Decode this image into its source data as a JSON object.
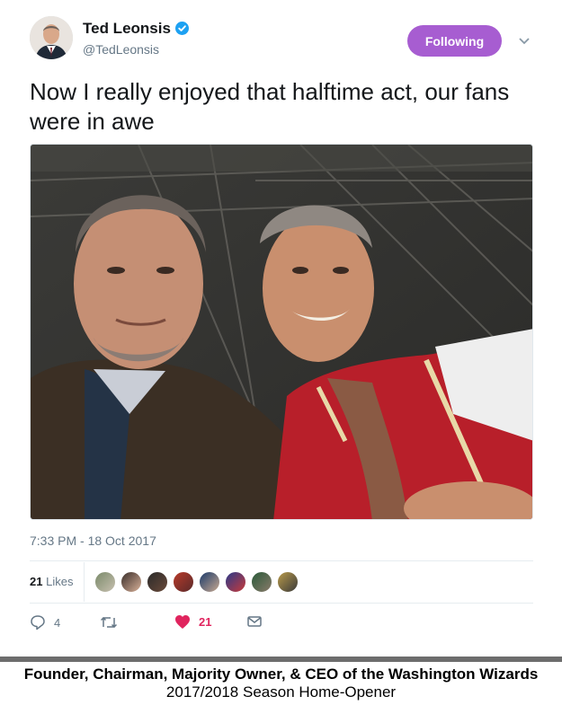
{
  "author": {
    "name": "Ted Leonsis",
    "handle": "@TedLeonsis",
    "verified_icon": "verified-badge-icon"
  },
  "follow_button": {
    "label": "Following",
    "color": "#a75dd1"
  },
  "menu_icon": "chevron-down-icon",
  "tweet": {
    "text": "Now I really enjoyed that halftime act, our fans were in awe",
    "timestamp": "7:33 PM - 18 Oct 2017"
  },
  "likes": {
    "count": "21",
    "label": "Likes",
    "liker_avatar_count": 8
  },
  "actions": {
    "reply_count": "4",
    "retweet_count": "",
    "like_count": "21",
    "like_color": "#e0245e"
  },
  "caption": {
    "line1": "Founder, Chairman, Majority Owner, & CEO of the Washington Wizards",
    "line2": "2017/2018 Season Home-Opener"
  }
}
